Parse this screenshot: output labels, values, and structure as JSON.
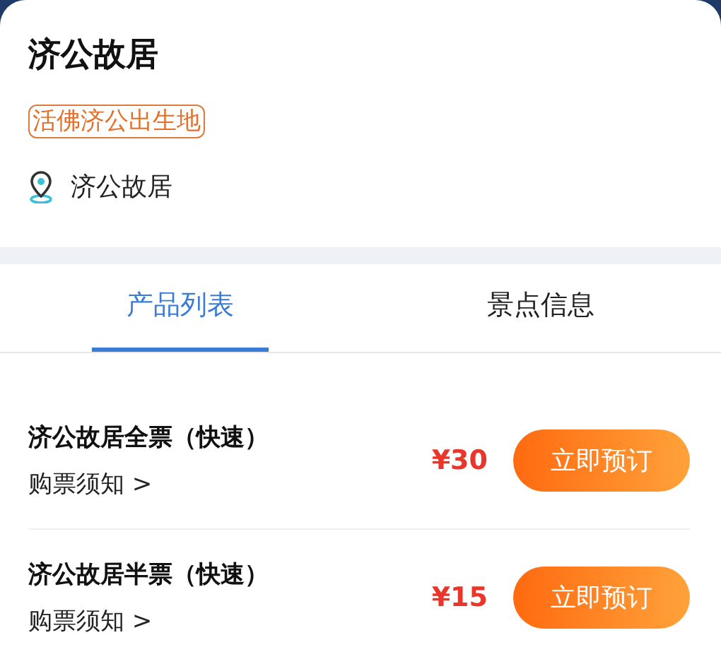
{
  "title": "济公故居",
  "tag": "活佛济公出生地",
  "location": "济公故居",
  "tabs": [
    {
      "label": "产品列表",
      "selected": true
    },
    {
      "label": "景点信息",
      "selected": false
    }
  ],
  "products": [
    {
      "name": "济公故居全票（快速）",
      "notice": "购票须知 >",
      "price": "¥30",
      "button": "立即预订"
    },
    {
      "name": "济公故居半票（快速）",
      "notice": "购票须知 >",
      "price": "¥15",
      "button": "立即预订"
    }
  ]
}
